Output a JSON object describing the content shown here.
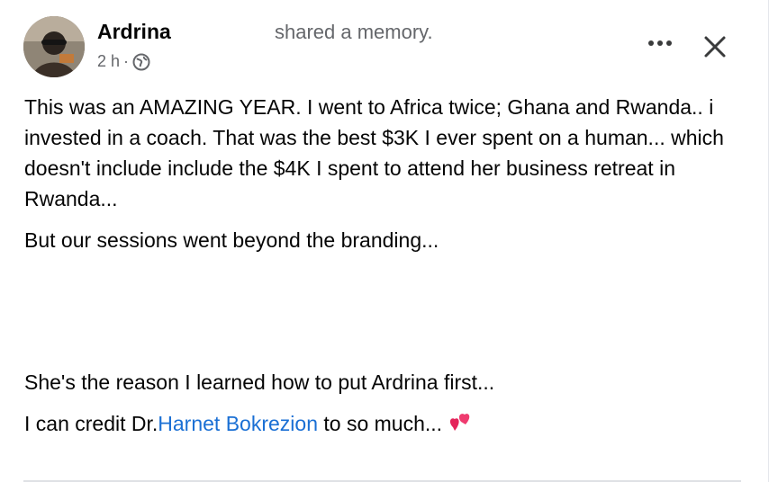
{
  "post": {
    "author": "Ardrina",
    "action": "shared a memory.",
    "time": "2 h",
    "separator": "·",
    "privacy_icon": "globe-icon",
    "more_icon": "more-horizontal-icon",
    "close_icon": "close-icon",
    "paragraph1_line1": "This was an AMAZING YEAR. I went to Africa twice; Ghana and",
    "paragraph1_line2": "Rwanda..",
    "paragraph1_line3": "i invested in a coach. That was the best $3K I ever spent on a human...",
    "paragraph1_line4": "which doesn't include include the $4K I spent to attend her business",
    "paragraph1_line5": "retreat in Rwanda...",
    "paragraph2": "But our sessions went beyond the branding...",
    "paragraph3": "She's the reason I learned how to put Ardrina first...",
    "paragraph4_prefix": "I can credit Dr.",
    "paragraph4_mention": "Harnet Bokrezion",
    "paragraph4_suffix": " to so much... ",
    "emoji": "two-hearts-icon",
    "colors": {
      "text": "#050505",
      "secondary": "#65676b",
      "link": "#1a6fd4",
      "heart": "#e4245a"
    }
  }
}
